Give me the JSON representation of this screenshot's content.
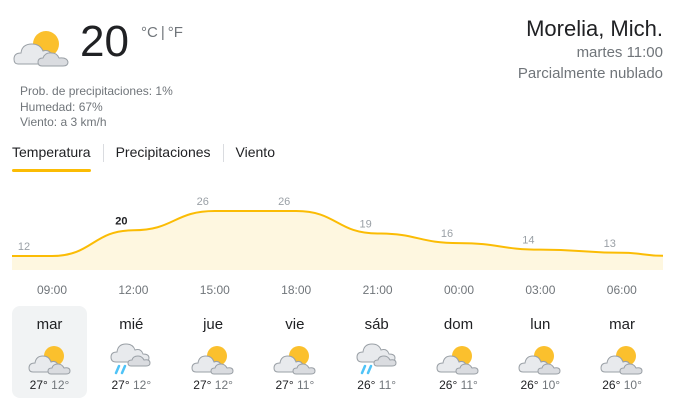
{
  "current": {
    "temp": "20",
    "unit_c": "°C",
    "unit_f": "°F",
    "icon": "partly-cloudy-icon",
    "precip": "Prob. de precipitaciones: 1%",
    "humidity": "Humedad: 67%",
    "wind": "Viento: a 3 km/h"
  },
  "location": {
    "name": "Morelia, Mich.",
    "time": "martes 11:00",
    "condition": "Parcialmente nublado"
  },
  "tabs": [
    {
      "label": "Temperatura",
      "active": true
    },
    {
      "label": "Precipitaciones",
      "active": false
    },
    {
      "label": "Viento",
      "active": false
    }
  ],
  "chart_data": {
    "type": "area",
    "series": [
      {
        "values": [
          12,
          20,
          26,
          26,
          19,
          16,
          14,
          13
        ]
      }
    ],
    "labels": [
      "12",
      "20",
      "26",
      "26",
      "19",
      "16",
      "14",
      "13"
    ],
    "x": [
      "09:00",
      "12:00",
      "15:00",
      "18:00",
      "21:00",
      "00:00",
      "03:00",
      "06:00"
    ],
    "colors": {
      "line": "#fbbc04",
      "fill": "#fef7e0"
    }
  },
  "days": [
    {
      "name": "mar",
      "icon": "partly-cloudy-icon",
      "hi": "27°",
      "lo": "12°",
      "selected": true
    },
    {
      "name": "mié",
      "icon": "rain-cloud-icon",
      "hi": "27°",
      "lo": "12°",
      "selected": false
    },
    {
      "name": "jue",
      "icon": "partly-cloudy-icon",
      "hi": "27°",
      "lo": "12°",
      "selected": false
    },
    {
      "name": "vie",
      "icon": "partly-cloudy-icon",
      "hi": "27°",
      "lo": "11°",
      "selected": false
    },
    {
      "name": "sáb",
      "icon": "rain-cloud-icon",
      "hi": "26°",
      "lo": "11°",
      "selected": false
    },
    {
      "name": "dom",
      "icon": "partly-cloudy-icon",
      "hi": "26°",
      "lo": "11°",
      "selected": false
    },
    {
      "name": "lun",
      "icon": "partly-cloudy-icon",
      "hi": "26°",
      "lo": "10°",
      "selected": false
    },
    {
      "name": "mar",
      "icon": "partly-cloudy-icon",
      "hi": "26°",
      "lo": "10°",
      "selected": false
    }
  ]
}
